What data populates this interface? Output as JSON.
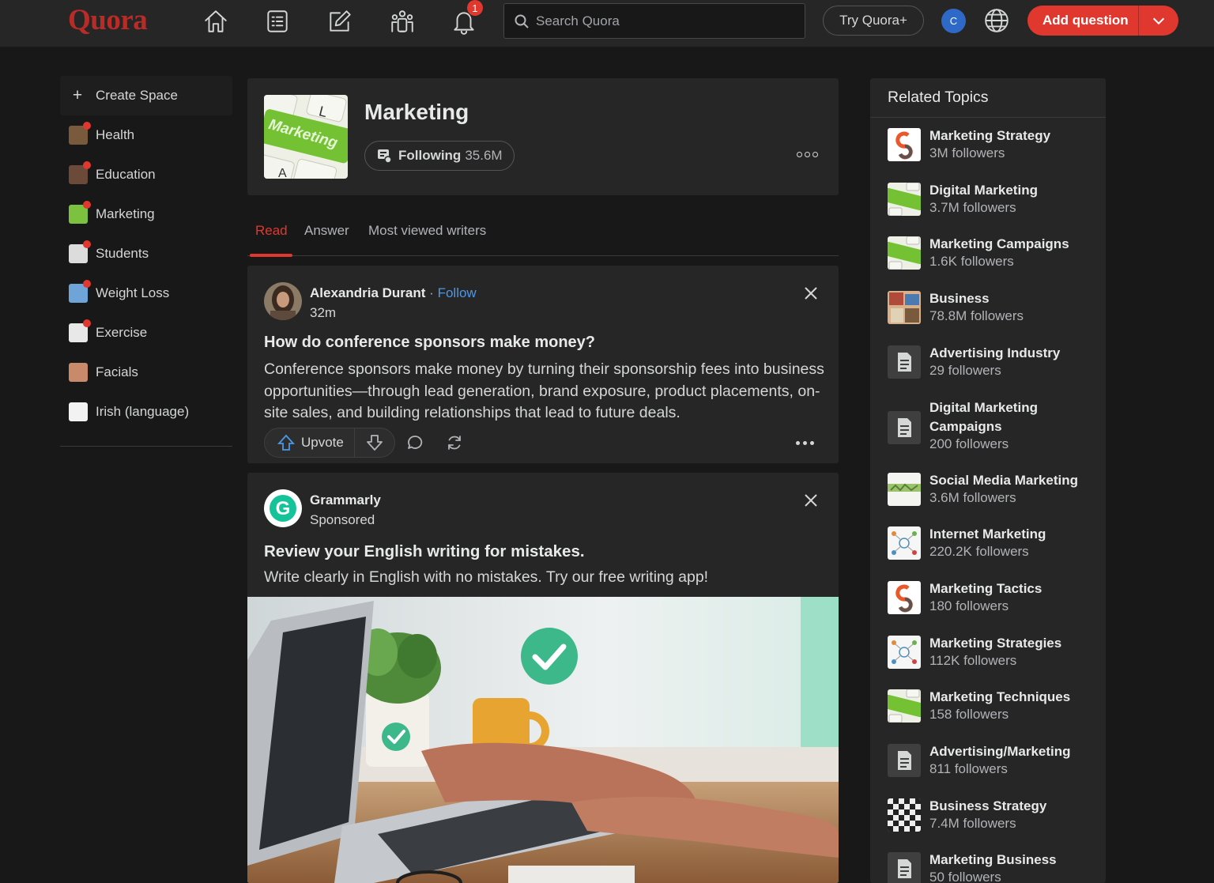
{
  "nav": {
    "logo": "Quora",
    "notification_count": "1",
    "search_placeholder": "Search Quora",
    "try_plus": "Try Quora+",
    "avatar_initial": "C",
    "add_question": "Add question",
    "icons": [
      "home-icon",
      "following-feed-icon",
      "answer-icon",
      "spaces-icon",
      "notifications-icon"
    ]
  },
  "sidebar": {
    "create_space": "Create Space",
    "items": [
      {
        "label": "Health",
        "dot": true,
        "color": "#7a5a3c"
      },
      {
        "label": "Education",
        "dot": true,
        "color": "#6b4a3a"
      },
      {
        "label": "Marketing",
        "dot": true,
        "color": "#7cc23f"
      },
      {
        "label": "Students",
        "dot": true,
        "color": "#dcdcdc"
      },
      {
        "label": "Weight Loss",
        "dot": true,
        "color": "#6fa4d8"
      },
      {
        "label": "Exercise",
        "dot": true,
        "color": "#e8e8e8"
      },
      {
        "label": "Facials",
        "dot": false,
        "color": "#c98a6b"
      },
      {
        "label": "Irish (language)",
        "dot": false,
        "color": "#f2f2f2"
      }
    ]
  },
  "topic": {
    "title": "Marketing",
    "following_label": "Following",
    "followers": "35.6M",
    "image_text": "Marketing"
  },
  "tabs": [
    "Read",
    "Answer",
    "Most viewed writers"
  ],
  "post": {
    "author": "Alexandria Durant",
    "follow": "Follow",
    "separator": "·",
    "time": "32m",
    "question": "How do conference sponsors make money?",
    "body": "Conference sponsors make money by turning their sponsorship fees into business opportunities—through lead generation, brand exposure, product placements, on-site sales, and building relationships that lead to future deals.",
    "upvote": "Upvote"
  },
  "ad": {
    "name": "Grammarly",
    "label": "Sponsored",
    "title": "Review your English writing for mistakes.",
    "body": "Write clearly in English with no mistakes. Try our free writing app!"
  },
  "related": {
    "heading": "Related Topics",
    "items": [
      {
        "name": "Marketing Strategy",
        "followers": "3M followers",
        "thumb": "logo"
      },
      {
        "name": "Digital Marketing",
        "followers": "3.7M followers",
        "thumb": "keyboard"
      },
      {
        "name": "Marketing Campaigns",
        "followers": "1.6K followers",
        "thumb": "keyboard"
      },
      {
        "name": "Business",
        "followers": "78.8M followers",
        "thumb": "collage"
      },
      {
        "name": "Advertising Industry",
        "followers": "29 followers",
        "thumb": "doc"
      },
      {
        "name": "Digital Marketing Campaigns",
        "followers": "200 followers",
        "thumb": "doc"
      },
      {
        "name": "Social Media Marketing",
        "followers": "3.6M followers",
        "thumb": "landscape"
      },
      {
        "name": "Internet Marketing",
        "followers": "220.2K followers",
        "thumb": "diagram"
      },
      {
        "name": "Marketing Tactics",
        "followers": "180 followers",
        "thumb": "logo"
      },
      {
        "name": "Marketing Strategies",
        "followers": "112K followers",
        "thumb": "diagram"
      },
      {
        "name": "Marketing Techniques",
        "followers": "158 followers",
        "thumb": "keyboard"
      },
      {
        "name": "Advertising/Marketing",
        "followers": "811 followers",
        "thumb": "doc"
      },
      {
        "name": "Business Strategy",
        "followers": "7.4M followers",
        "thumb": "chess"
      },
      {
        "name": "Marketing Business",
        "followers": "50 followers",
        "thumb": "doc"
      }
    ]
  },
  "colors": {
    "brand": "#b92b27",
    "accent": "#e0382f",
    "link": "#4c97e8",
    "background": "#181818",
    "card": "#262626"
  }
}
